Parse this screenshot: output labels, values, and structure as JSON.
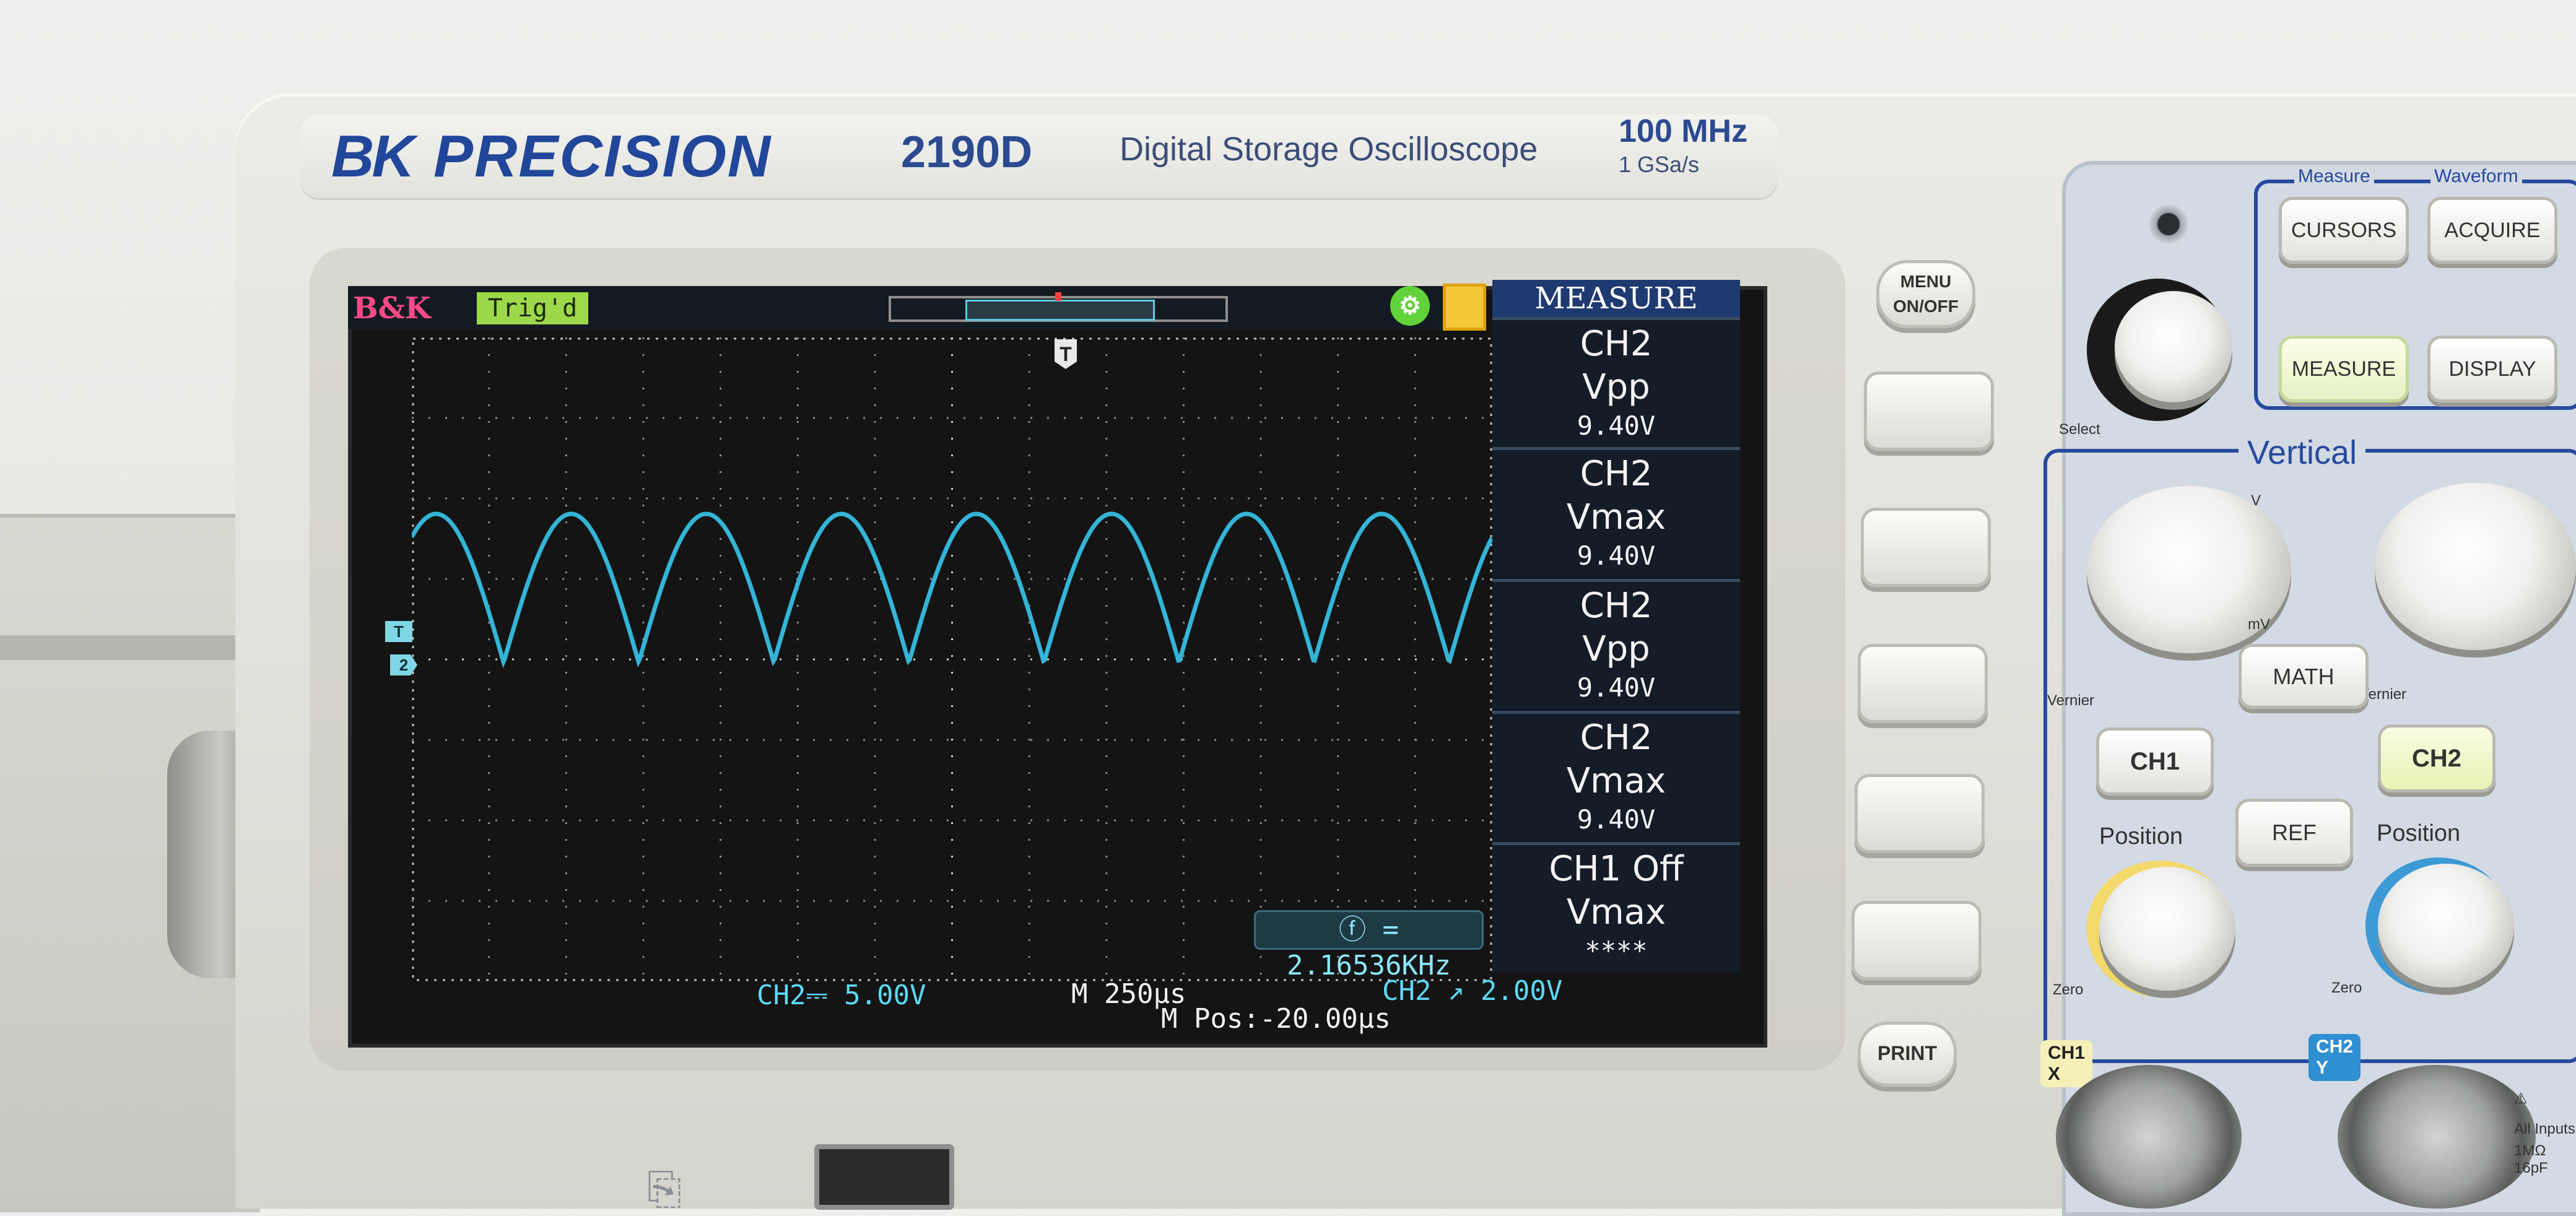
{
  "brand": {
    "logo": "BK",
    "name": "PRECISION"
  },
  "model": "2190D",
  "description": "Digital Storage Oscilloscope",
  "specs": {
    "bandwidth": "100 MHz",
    "sample_rate": "1 GSa/s"
  },
  "screen": {
    "logo": "B&K",
    "trigger_status": "Trig'd",
    "trigger_marker": "T",
    "ch2_marker": "2",
    "freq_readout": "ⓕ = 2.16536KHz",
    "ch2_scale": "CH2⎓ 5.00V",
    "timebase": "M 250μs",
    "trigger_info": "CH2 ↗ 2.00V",
    "m_pos": "M Pos:-20.00μs",
    "waveform_color": "#34b4d6",
    "measure": {
      "title": "MEASURE",
      "items": [
        {
          "source": "CH2",
          "type": "Vpp",
          "value": "9.40V"
        },
        {
          "source": "CH2",
          "type": "Vmax",
          "value": "9.40V"
        },
        {
          "source": "CH2",
          "type": "Vpp",
          "value": "9.40V"
        },
        {
          "source": "CH2",
          "type": "Vmax",
          "value": "9.40V"
        },
        {
          "source": "CH1 Off",
          "type": "Vmax",
          "value": "****"
        }
      ]
    },
    "waveform": {
      "type": "full-wave rectified",
      "cycles": 8
    }
  },
  "bezel": {
    "menu_label": "MENU ON/OFF",
    "print_label": "PRINT"
  },
  "panel": {
    "measure_group": "Measure",
    "waveform_group": "Waveform",
    "cursors": "CURSORS",
    "acquire": "ACQUIRE",
    "measure": "MEASURE",
    "display": "DISPLAY",
    "select": "Select",
    "vertical": "Vertical",
    "math": "MATH",
    "ref": "REF",
    "ch1": "CH1",
    "ch2": "CH2",
    "position": "Position",
    "vernier": "Vernier",
    "zero": "Zero",
    "mv": "mV",
    "v": "V",
    "ch1_input": "CH1",
    "ch1_axis": "X",
    "ch2_input": "CH2",
    "ch2_axis": "Y",
    "all_inputs": "All Inputs",
    "input_spec": "1MΩ 16pF"
  },
  "colors": {
    "brand": "#22479a",
    "screen_bg": "#141414",
    "trace": "#34b4d6",
    "panel_accent": "#274a9e"
  }
}
